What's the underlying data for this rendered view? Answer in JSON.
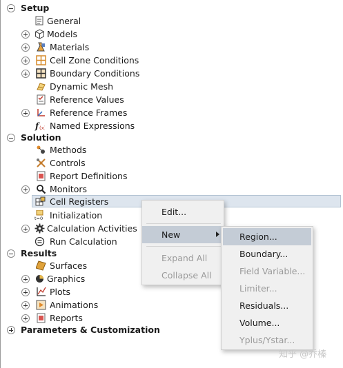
{
  "tree": {
    "setup": {
      "label": "Setup",
      "items": {
        "general": "General",
        "models": "Models",
        "materials": "Materials",
        "cell_zone": "Cell Zone Conditions",
        "boundary": "Boundary Conditions",
        "dynamic_mesh": "Dynamic Mesh",
        "reference_values": "Reference Values",
        "reference_frames": "Reference Frames",
        "named_expressions": "Named Expressions"
      }
    },
    "solution": {
      "label": "Solution",
      "items": {
        "methods": "Methods",
        "controls": "Controls",
        "report_definitions": "Report Definitions",
        "monitors": "Monitors",
        "cell_registers": "Cell Registers",
        "initialization": "Initialization",
        "calculation_activities": "Calculation Activities",
        "run_calculation": "Run Calculation"
      }
    },
    "results": {
      "label": "Results",
      "items": {
        "surfaces": "Surfaces",
        "graphics": "Graphics",
        "plots": "Plots",
        "animations": "Animations",
        "reports": "Reports"
      }
    },
    "parameters": {
      "label": "Parameters & Customization"
    }
  },
  "context_menu": {
    "edit": "Edit...",
    "new": "New",
    "expand_all": "Expand All",
    "collapse_all": "Collapse All"
  },
  "submenu": {
    "region": "Region...",
    "boundary": "Boundary...",
    "field_variable": "Field Variable...",
    "limiter": "Limiter...",
    "residuals": "Residuals...",
    "volume": "Volume...",
    "yplus_ystar": "Yplus/Ystar..."
  },
  "watermark": "知乎 @乔榛",
  "colors": {
    "selection": "#dde5ee",
    "menu_bg": "#f0f0f0",
    "menu_highlight": "#c4ccd6",
    "disabled_text": "#9a9a9a"
  }
}
